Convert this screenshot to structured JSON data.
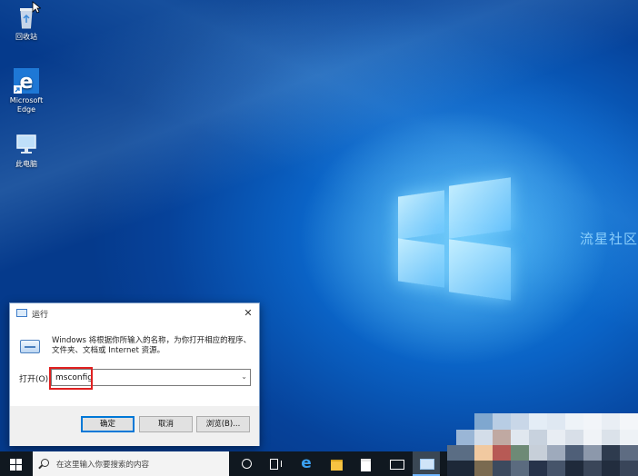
{
  "desktop": {
    "icons": [
      {
        "label": "回收站"
      },
      {
        "label": "Microsoft Edge"
      },
      {
        "label": "此电脑"
      }
    ],
    "watermark": "流星社区"
  },
  "run_dialog": {
    "title": "运行",
    "close_glyph": "✕",
    "description": "Windows 将根据你所输入的名称，为你打开相应的程序、文件夹、文档或 Internet 资源。",
    "open_label": "打开(O):",
    "open_value": "msconfig",
    "dropdown_glyph": "⌄",
    "buttons": {
      "ok": "确定",
      "cancel": "取消",
      "browse": "浏览(B)..."
    }
  },
  "taskbar": {
    "search_placeholder": "在这里输入你要搜索的内容",
    "edge_glyph": "e"
  }
}
